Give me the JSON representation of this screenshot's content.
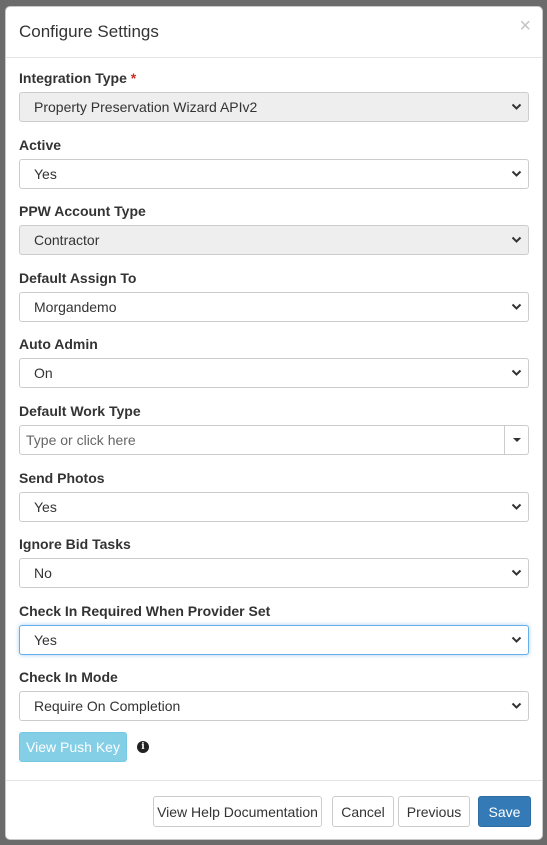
{
  "modal": {
    "title": "Configure Settings",
    "close_symbol": "×"
  },
  "fields": [
    {
      "label": "Integration Type",
      "required_mark": "*",
      "value": "Property Preservation Wizard APIv2",
      "disabled": true
    },
    {
      "label": "Active",
      "value": "Yes"
    },
    {
      "label": "PPW Account Type",
      "value": "Contractor",
      "disabled": true
    },
    {
      "label": "Default Assign To",
      "value": "Morgandemo"
    },
    {
      "label": "Auto Admin",
      "value": "On"
    },
    {
      "label": "Default Work Type",
      "placeholder": "Type or click here"
    },
    {
      "label": "Send Photos",
      "value": "Yes"
    },
    {
      "label": "Ignore Bid Tasks",
      "value": "No"
    },
    {
      "label": "Check In Required When Provider Set",
      "value": "Yes",
      "focused": true
    },
    {
      "label": "Check In Mode",
      "value": "Require On Completion"
    }
  ],
  "push_key": {
    "button_label": "View Push Key",
    "icon": "info-icon",
    "icon_glyph": "i"
  },
  "footer": {
    "help_label": "View Help Documentation",
    "cancel_label": "Cancel",
    "previous_label": "Previous",
    "save_label": "Save"
  },
  "colors": {
    "primary": "#337ab7",
    "info": "#5bc0de",
    "required": "#c9302c",
    "focus": "#66afe9"
  }
}
